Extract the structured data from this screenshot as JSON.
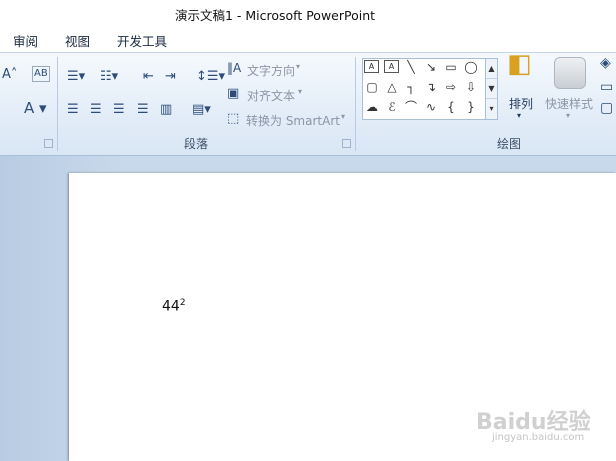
{
  "window": {
    "title": "演示文稿1 - Microsoft PowerPoint"
  },
  "tabs": [
    {
      "label": "审阅"
    },
    {
      "label": "视图"
    },
    {
      "label": "开发工具"
    }
  ],
  "paragraph": {
    "text_direction": "文字方向",
    "align_text": "对齐文本",
    "convert_smartart": "转换为 SmartArt",
    "group_label": "段落"
  },
  "drawing": {
    "arrange": "排列",
    "quick_styles": "快速样式",
    "group_label": "绘图"
  },
  "slide": {
    "base": "44",
    "superscript": "2"
  },
  "watermark": {
    "brand": "Baidu经验",
    "url": "jingyan.baidu.com"
  }
}
